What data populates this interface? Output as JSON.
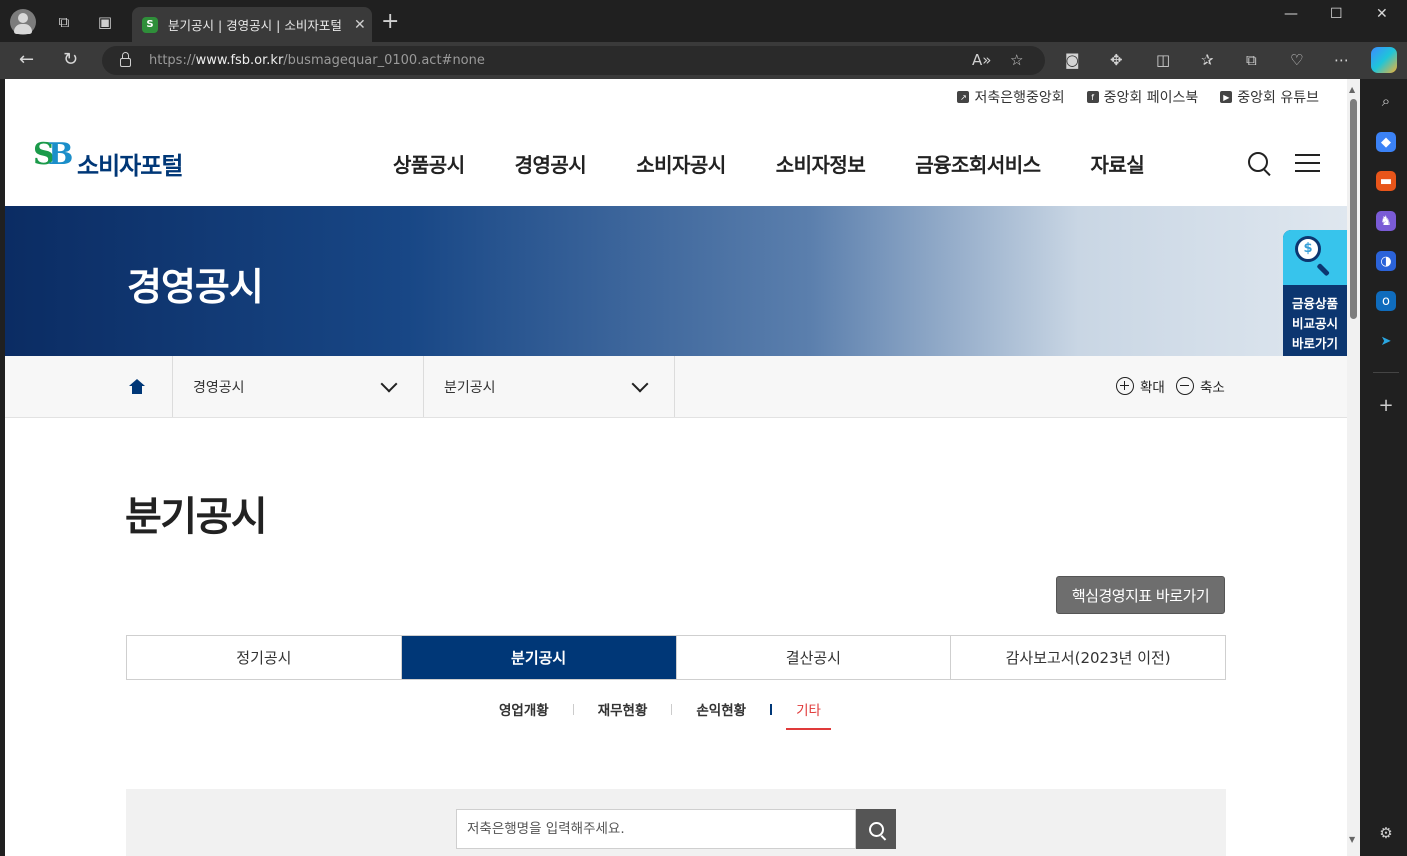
{
  "browser": {
    "tab_title": "분기공시 | 경영공시 | 소비자포털",
    "url_prefix": "https://",
    "url_host": "www.fsb.or.kr",
    "url_path": "/busmagequar_0100.act#none"
  },
  "site": {
    "top_links": [
      "저축은행중앙회",
      "중앙회 페이스북",
      "중앙회 유튜브"
    ],
    "logo_text": "소비자포털",
    "gnb": [
      "상품공시",
      "경영공시",
      "소비자공시",
      "소비자정보",
      "금융조회서비스",
      "자료실"
    ],
    "hero_title": "경영공시",
    "quick_link": [
      "금융상품",
      "비교공시",
      "바로가기"
    ],
    "breadcrumb": {
      "level1": "경영공시",
      "level2": "분기공시"
    },
    "zoom_in": "확대",
    "zoom_out": "축소",
    "page_title": "분기공시",
    "key_indicator_button": "핵심경영지표 바로가기",
    "tabs": [
      "정기공시",
      "분기공시",
      "결산공시",
      "감사보고서(2023년 이전)"
    ],
    "active_tab": 1,
    "subtabs": [
      "영업개황",
      "재무현황",
      "손익현황",
      "기타"
    ],
    "active_subtab": 3,
    "search_placeholder": "저축은행명을 입력해주세요."
  }
}
